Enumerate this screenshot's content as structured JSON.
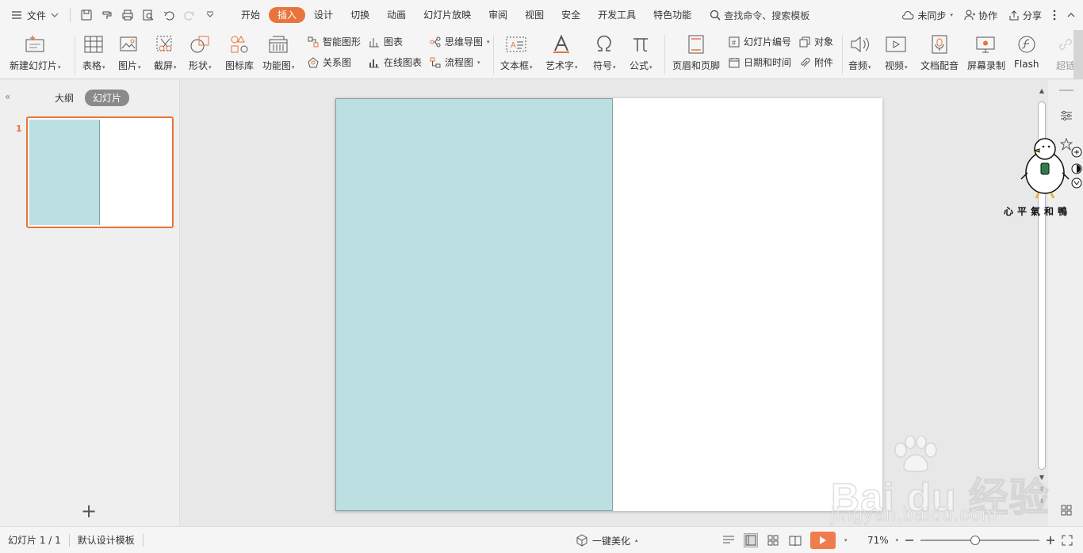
{
  "menubar": {
    "file_label": "文件",
    "tabs": [
      "开始",
      "插入",
      "设计",
      "切换",
      "动画",
      "幻灯片放映",
      "审阅",
      "视图",
      "安全",
      "开发工具",
      "特色功能"
    ],
    "active_tab_index": 1,
    "search_label": "查找命令、搜索模板",
    "sync_label": "未同步",
    "collab_label": "协作",
    "share_label": "分享"
  },
  "ribbon": {
    "new_slide": "新建幻灯片",
    "table": "表格",
    "picture": "图片",
    "screenshot": "截屏",
    "shape": "形状",
    "icon_lib": "图标库",
    "function_chart": "功能图",
    "smart_shape": "智能图形",
    "chart": "图表",
    "relation": "关系图",
    "online_chart": "在线图表",
    "mindmap": "思维导图",
    "flowchart": "流程图",
    "textbox": "文本框",
    "wordart": "艺术字",
    "symbol": "符号",
    "formula": "公式",
    "header_footer": "页眉和页脚",
    "slide_number": "幻灯片编号",
    "object": "对象",
    "date_time": "日期和时间",
    "attachment": "附件",
    "audio": "音频",
    "video": "视频",
    "doc_dubbing": "文档配音",
    "screen_record": "屏幕录制",
    "flash": "Flash",
    "hyperlink": "超链"
  },
  "left_panel": {
    "tab_outline": "大纲",
    "tab_slides": "幻灯片",
    "slide_number": "1"
  },
  "mascot": {
    "caption": "心平氣和鴨"
  },
  "statusbar": {
    "slide_info": "幻灯片 1 / 1",
    "template": "默认设计模板",
    "beautify": "一键美化",
    "zoom": "71%",
    "zoom_level": 0.46
  },
  "watermark": {
    "main": "Bai du 经验",
    "sub": "jingyan.baidu.com"
  },
  "colors": {
    "accent": "#e8743b",
    "slide_block": "#bcdfe2"
  }
}
